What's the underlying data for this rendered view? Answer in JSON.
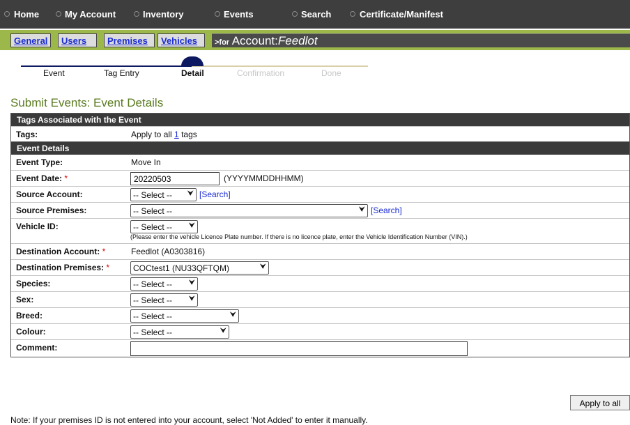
{
  "topnav": {
    "home": "Home",
    "my_account": "My Account",
    "inventory": "Inventory",
    "events": "Events",
    "search": "Search",
    "certificate": "Certificate/Manifest"
  },
  "subnav": {
    "general": "General",
    "users": "Users",
    "premises": "Premises",
    "vehicles": "Vehicles",
    "for_prefix": ">for",
    "account_word": "Account:",
    "account_name": "Feedlot"
  },
  "steps": [
    "Event",
    "Tag Entry",
    "Detail",
    "Confirmation",
    "Done"
  ],
  "page_title": "Submit Events: Event Details",
  "tags_section": {
    "heading": "Tags Associated with the Event",
    "tags_label": "Tags:",
    "apply_prefix": "Apply to all",
    "tag_count": "1",
    "tags_suffix": "tags"
  },
  "details": {
    "heading": "Event Details",
    "event_type_label": "Event Type:",
    "event_type_value": "Move In",
    "event_date_label": "Event Date:",
    "required_mark": "*",
    "event_date_value": "20220503",
    "event_date_format": "(YYYYMMDDHHMM)",
    "source_account_label": "Source Account:",
    "source_premises_label": "Source Premises:",
    "vehicle_id_label": "Vehicle ID:",
    "vehicle_hint": "(Please enter the vehicle Licence Plate number. If there is no licence plate, enter the Vehicle Identification Number (VIN).)",
    "dest_account_label": "Destination Account:",
    "dest_account_value": "Feedlot (A0303816)",
    "dest_premises_label": "Destination Premises:",
    "dest_premises_value": "COCtest1 (NU33QFTQM)",
    "species_label": "Species:",
    "sex_label": "Sex:",
    "breed_label": "Breed:",
    "colour_label": "Colour:",
    "comment_label": "Comment:",
    "comment_value": "",
    "select_label": "-- Select --",
    "search_link": "[Search]"
  },
  "apply_button": "Apply to all",
  "note": "Note: If your premises ID is not entered into your account, select 'Not Added' to enter it manually."
}
